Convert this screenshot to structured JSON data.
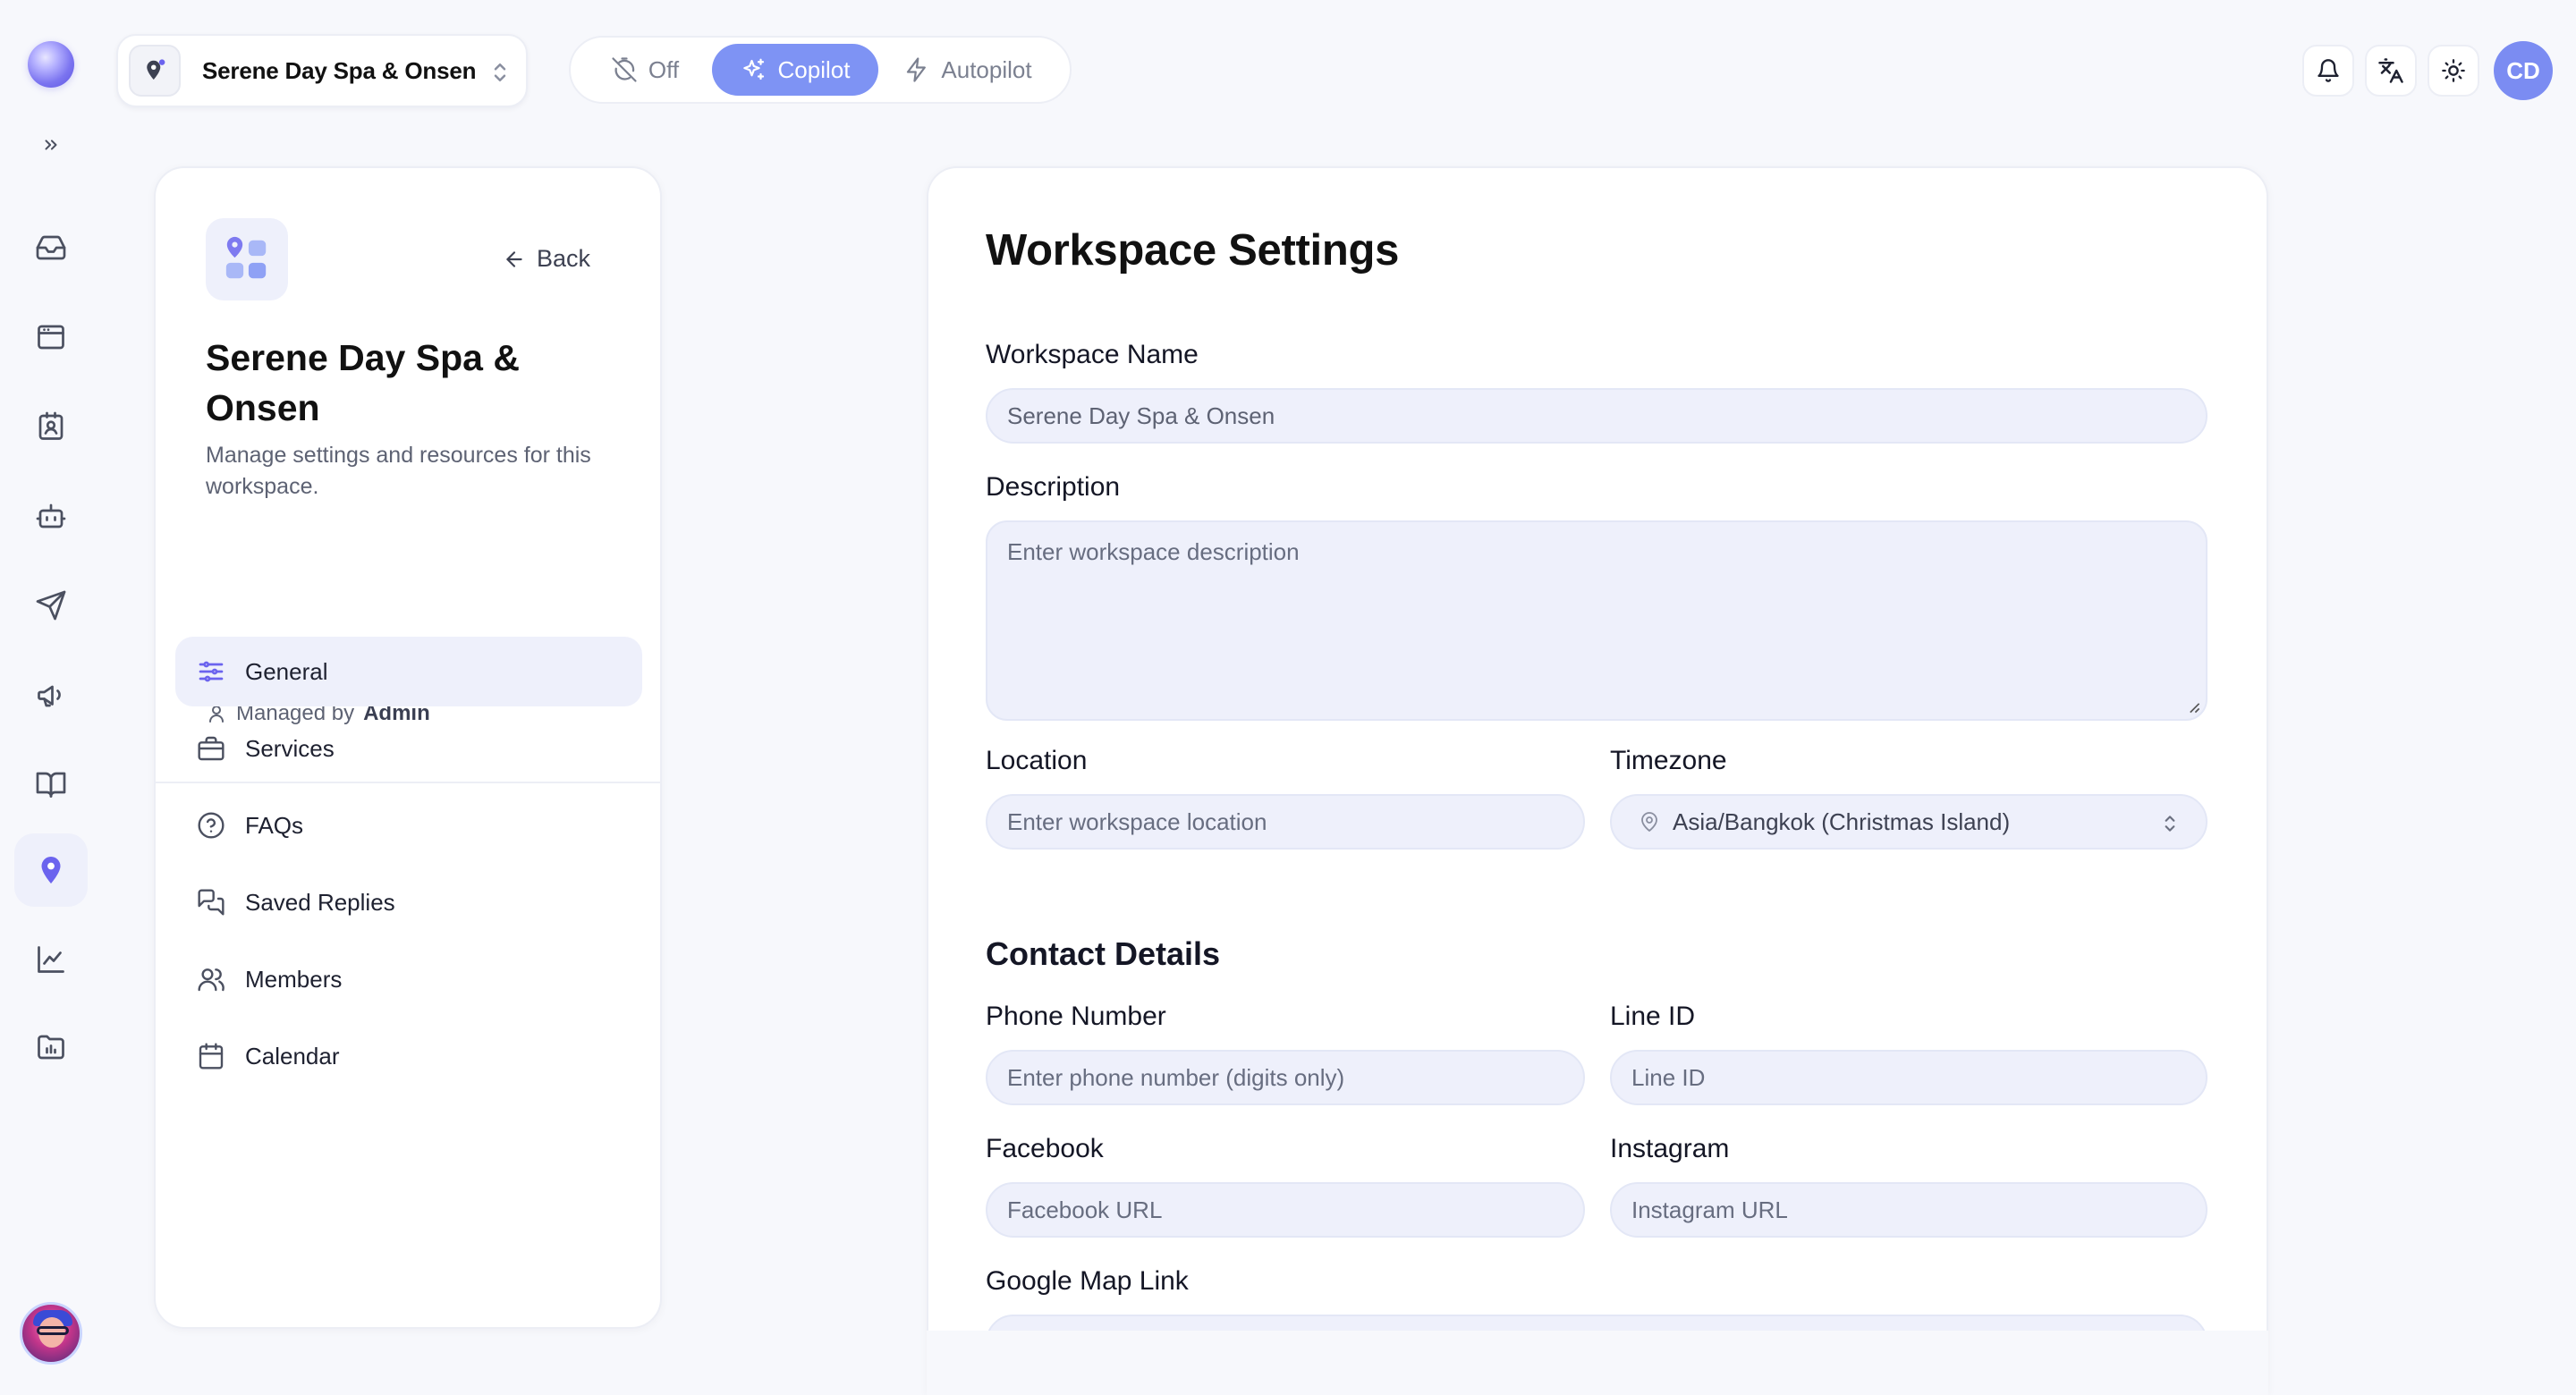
{
  "app": {
    "workspace_switcher": {
      "name": "Serene Day Spa & Onsen"
    },
    "modes": [
      {
        "label": "Off",
        "icon": "timer-off-icon",
        "active": false
      },
      {
        "label": "Copilot",
        "icon": "sparkles-icon",
        "active": true
      },
      {
        "label": "Autopilot",
        "icon": "bolt-icon",
        "active": false
      }
    ],
    "user_initials": "CD",
    "accent_color": "#7e93f4"
  },
  "rail": {
    "items": [
      {
        "icon": "inbox-icon"
      },
      {
        "icon": "browser-window-icon"
      },
      {
        "icon": "contact-card-icon"
      },
      {
        "icon": "bot-icon"
      },
      {
        "icon": "send-icon"
      },
      {
        "icon": "megaphone-icon"
      },
      {
        "icon": "book-icon"
      },
      {
        "icon": "map-pin-icon",
        "active": true
      },
      {
        "icon": "line-chart-icon"
      },
      {
        "icon": "folder-chart-icon"
      }
    ]
  },
  "sidebar": {
    "back_label": "Back",
    "title": "Serene Day Spa & Onsen",
    "description": "Manage settings and resources for this workspace.",
    "managed_prefix": "Managed by",
    "managed_by": "Admin",
    "nav": [
      {
        "label": "General",
        "icon": "sliders-icon",
        "active": true
      },
      {
        "label": "Services",
        "icon": "briefcase-icon"
      },
      {
        "label": "FAQs",
        "icon": "help-circle-icon"
      },
      {
        "label": "Saved Replies",
        "icon": "chat-bubbles-icon"
      },
      {
        "label": "Members",
        "icon": "users-icon"
      },
      {
        "label": "Calendar",
        "icon": "calendar-icon"
      }
    ]
  },
  "main": {
    "title": "Workspace Settings",
    "workspace_name": {
      "label": "Workspace Name",
      "value": "Serene Day Spa & Onsen"
    },
    "description": {
      "label": "Description",
      "placeholder": "Enter workspace description"
    },
    "location": {
      "label": "Location",
      "placeholder": "Enter workspace location"
    },
    "timezone": {
      "label": "Timezone",
      "value": "Asia/Bangkok (Christmas Island)"
    },
    "contact_title": "Contact Details",
    "phone": {
      "label": "Phone Number",
      "placeholder": "Enter phone number (digits only)"
    },
    "line_id": {
      "label": "Line ID",
      "placeholder": "Line ID"
    },
    "facebook": {
      "label": "Facebook",
      "placeholder": "Facebook URL"
    },
    "instagram": {
      "label": "Instagram",
      "placeholder": "Instagram URL"
    },
    "google_map": {
      "label": "Google Map Link"
    }
  }
}
